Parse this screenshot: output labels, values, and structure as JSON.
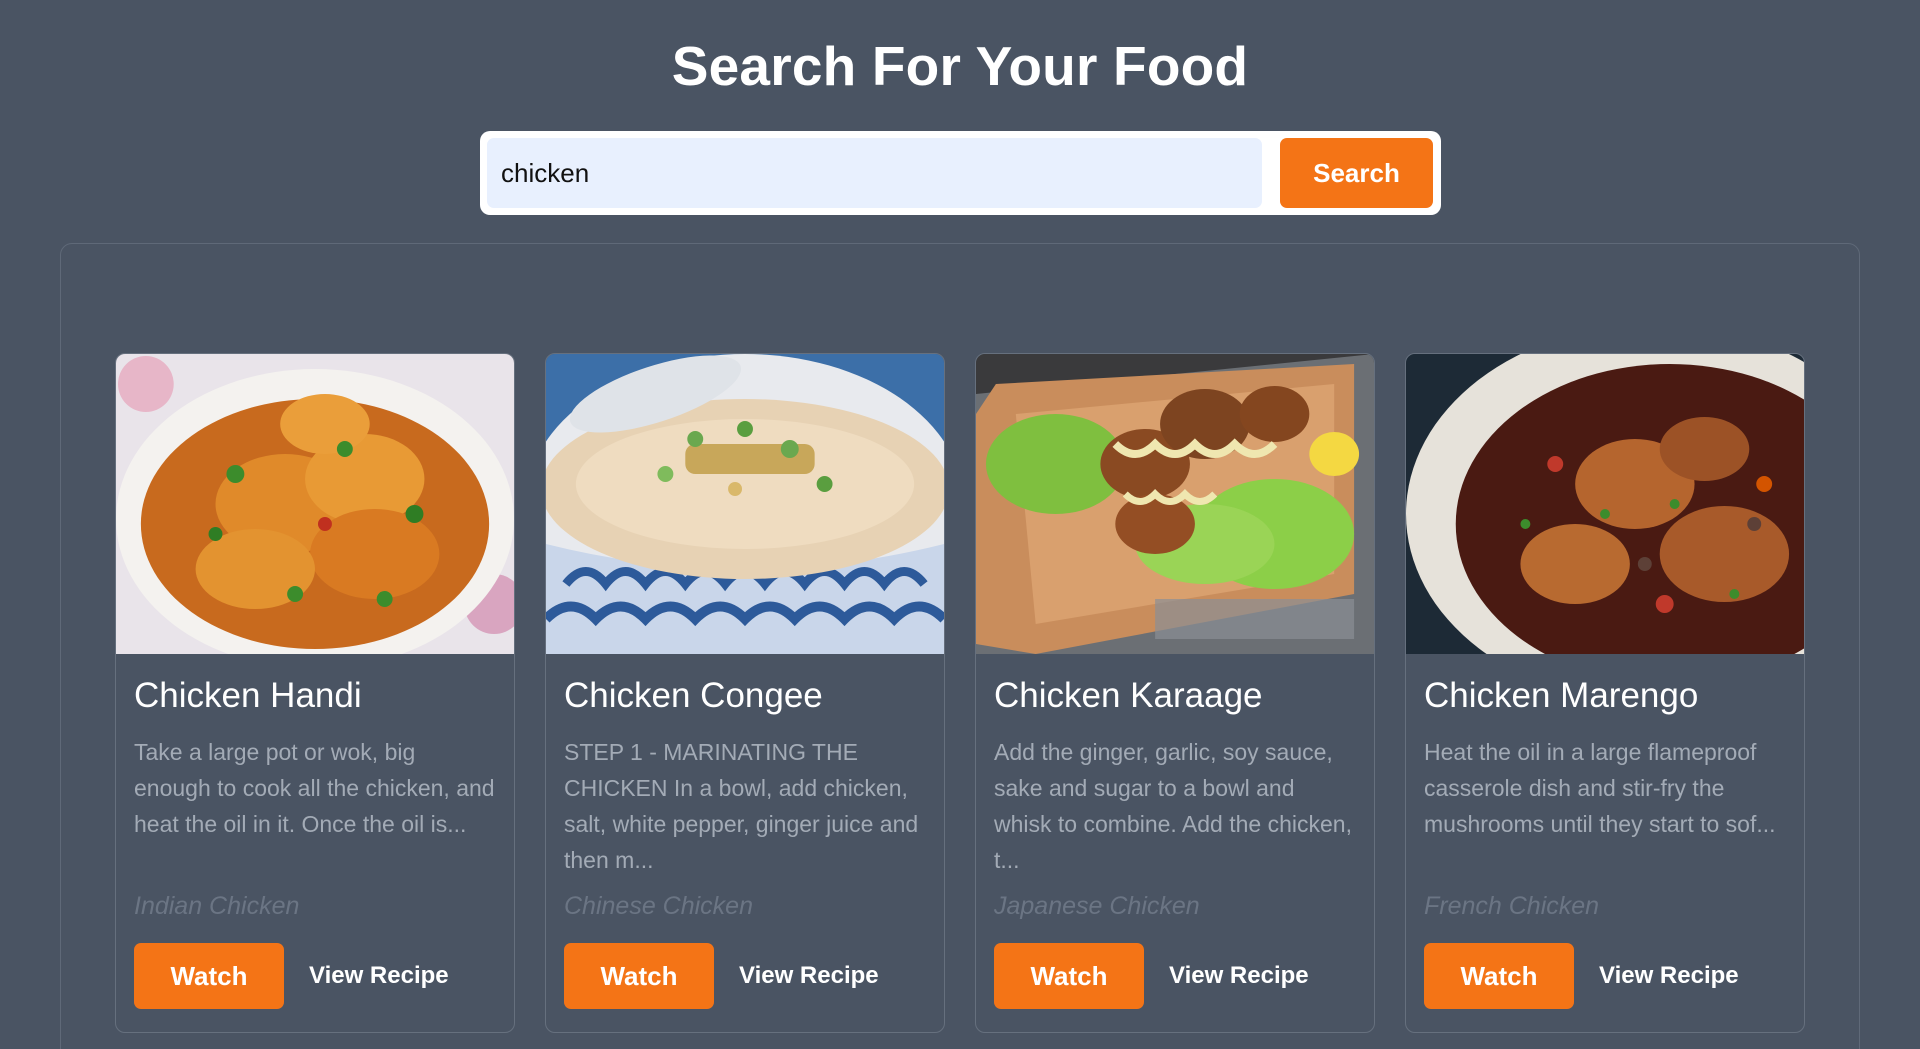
{
  "header": {
    "title": "Search For Your Food"
  },
  "search": {
    "value": "chicken",
    "button_label": "Search"
  },
  "colors": {
    "background": "#4a5463",
    "accent": "#f47416",
    "input_bg": "#e8f0fe"
  },
  "results": [
    {
      "title": "Chicken Handi",
      "description": "Take a large pot or wok, big enough to cook all the chicken, and heat the oil in it. Once the oil is...",
      "area_category": "Indian Chicken",
      "watch_label": "Watch",
      "view_label": "View Recipe"
    },
    {
      "title": "Chicken Congee",
      "description": "STEP 1 - MARINATING THE CHICKEN In a bowl, add chicken, salt, white pepper, ginger juice and then m...",
      "area_category": "Chinese Chicken",
      "watch_label": "Watch",
      "view_label": "View Recipe"
    },
    {
      "title": "Chicken Karaage",
      "description": "Add the ginger, garlic, soy sauce, sake and sugar to a bowl and whisk to combine. Add the chicken, t...",
      "area_category": "Japanese Chicken",
      "watch_label": "Watch",
      "view_label": "View Recipe"
    },
    {
      "title": "Chicken Marengo",
      "description": "Heat the oil in a large flameproof casserole dish and stir-fry the mushrooms until they start to sof...",
      "area_category": "French Chicken",
      "watch_label": "Watch",
      "view_label": "View Recipe"
    }
  ]
}
